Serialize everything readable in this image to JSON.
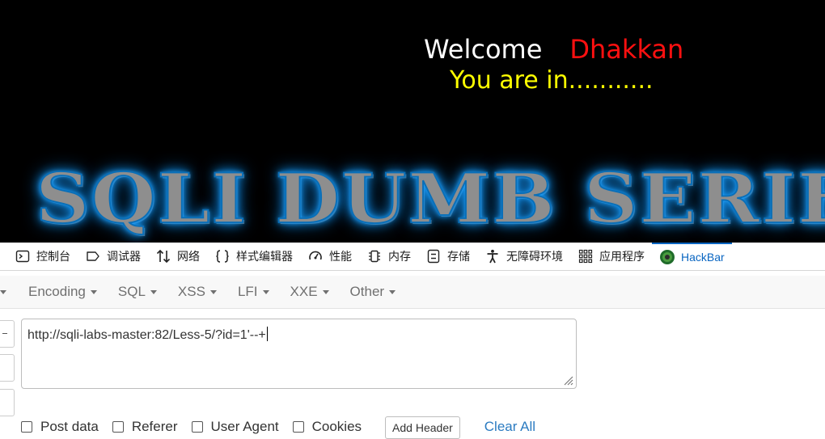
{
  "page": {
    "welcome": "Welcome",
    "username": "Dhakkan",
    "status": "You are in...........",
    "banner": "SQLI DUMB SERIES"
  },
  "devtools": {
    "tabs": [
      {
        "label": "控制台",
        "icon": "console-icon"
      },
      {
        "label": "调试器",
        "icon": "debugger-icon"
      },
      {
        "label": "网络",
        "icon": "network-icon"
      },
      {
        "label": "样式编辑器",
        "icon": "style-editor-icon"
      },
      {
        "label": "性能",
        "icon": "performance-icon"
      },
      {
        "label": "内存",
        "icon": "memory-icon"
      },
      {
        "label": "存储",
        "icon": "storage-icon"
      },
      {
        "label": "无障碍环境",
        "icon": "accessibility-icon"
      },
      {
        "label": "应用程序",
        "icon": "application-icon"
      },
      {
        "label": "HackBar",
        "icon": "hackbar-icon",
        "active": true
      }
    ],
    "accent": "#0a66c2"
  },
  "hackbar": {
    "menu": [
      {
        "label": "Encoding"
      },
      {
        "label": "SQL"
      },
      {
        "label": "XSS"
      },
      {
        "label": "LFI"
      },
      {
        "label": "XXE"
      },
      {
        "label": "Other"
      }
    ],
    "url_value": "http://sqli-labs-master:82/Less-5/?id=1'--+",
    "options": [
      {
        "label": "Post data",
        "checked": false
      },
      {
        "label": "Referer",
        "checked": false
      },
      {
        "label": "User Agent",
        "checked": false
      },
      {
        "label": "Cookies",
        "checked": false
      }
    ],
    "add_header": "Add Header",
    "clear_all": "Clear All",
    "link_color": "#2b7bc1"
  }
}
